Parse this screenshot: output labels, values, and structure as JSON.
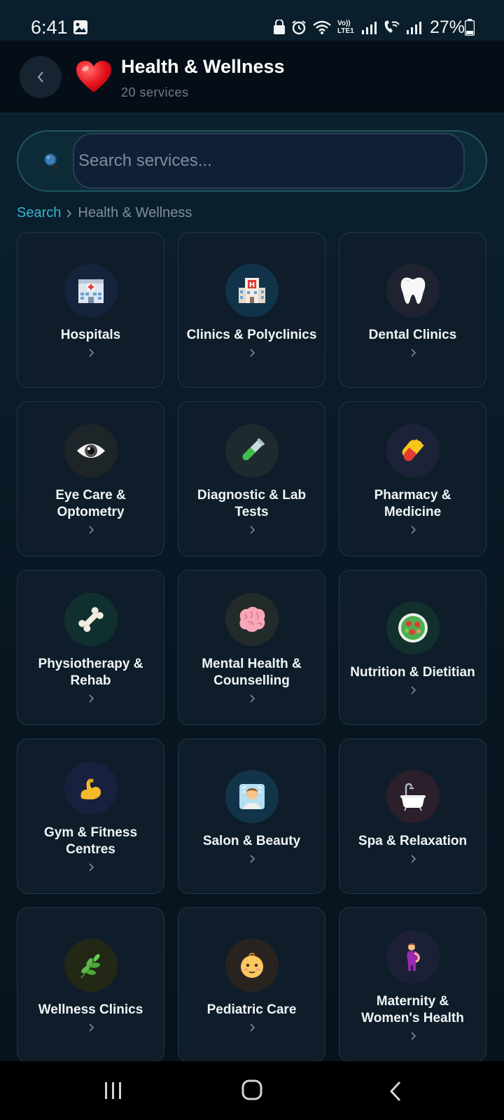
{
  "status_bar": {
    "time": "6:41",
    "battery": "27%",
    "network_label": "Vo)) LTE1"
  },
  "header": {
    "title": "Health & Wellness",
    "subtitle": "20 services"
  },
  "search": {
    "placeholder": "Search services..."
  },
  "breadcrumb": {
    "root": "Search",
    "current": "Health & Wellness"
  },
  "services": [
    {
      "label": "Hospitals",
      "icon": "hospital-icon",
      "bg": "#16233c"
    },
    {
      "label": "Clinics & Polyclinics",
      "icon": "clinic-icon",
      "bg": "#11334a"
    },
    {
      "label": "Dental Clinics",
      "icon": "tooth-icon",
      "bg": "#1f2331"
    },
    {
      "label": "Eye Care & Optometry",
      "icon": "eye-icon",
      "bg": "#1e2529"
    },
    {
      "label": "Diagnostic & Lab Tests",
      "icon": "test-tube-icon",
      "bg": "#1f2a2e"
    },
    {
      "label": "Pharmacy & Medicine",
      "icon": "pill-icon",
      "bg": "#1c2237"
    },
    {
      "label": "Physiotherapy & Rehab",
      "icon": "bone-icon",
      "bg": "#10302f"
    },
    {
      "label": "Mental Health & Counselling",
      "icon": "brain-icon",
      "bg": "#222a2a"
    },
    {
      "label": "Nutrition & Dietitian",
      "icon": "salad-icon",
      "bg": "#12302d"
    },
    {
      "label": "Gym & Fitness Centres",
      "icon": "flexed-biceps-icon",
      "bg": "#17213d"
    },
    {
      "label": "Salon & Beauty",
      "icon": "person-getting-haircut-icon",
      "bg": "#11344a"
    },
    {
      "label": "Spa & Relaxation",
      "icon": "bathtub-icon",
      "bg": "#2a1f2b"
    },
    {
      "label": "Wellness Clinics",
      "icon": "herb-icon",
      "bg": "#222716"
    },
    {
      "label": "Pediatric Care",
      "icon": "baby-icon",
      "bg": "#292320"
    },
    {
      "label": "Maternity & Women's Health",
      "icon": "pregnant-woman-icon",
      "bg": "#1b2037"
    }
  ],
  "colors": {
    "accent": "#32b6d6",
    "card_bg": "#0e1d29",
    "card_border": "#1e3848",
    "header_bg": "#050e16"
  }
}
